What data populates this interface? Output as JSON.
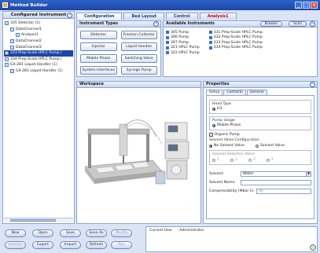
{
  "window": {
    "title": "Method Builder"
  },
  "left_panel": {
    "title": "Configured Instrument",
    "tree": [
      "335 Detector (1)",
      "DataChannel1",
      "Analysis1",
      "DataChannel2",
      "DataChannel3",
      "333 Prep-Scale HPLC Pump (",
      "334 Prep-Scale HPLC Pump (",
      "GX-281 Liquid Handler (1)",
      "GX-281 Liquid Handler (1)"
    ]
  },
  "tabs": [
    "Configuration",
    "Bed Layout",
    "Control",
    "Analysis1"
  ],
  "instrument_types": {
    "title": "Instrument Types",
    "buttons": [
      "Detector",
      "Fraction Collector",
      "Injector",
      "Liquid Handler",
      "Mobile Phase",
      "Switching Valve",
      "System Interfaces",
      "Syringe Pump"
    ]
  },
  "available": {
    "title": "Available Instruments",
    "browse": "Browse",
    "scan": "Scan",
    "col1": [
      "305 Pump",
      "306 Pump",
      "307 Pump",
      "321 HPLC Pump",
      "322 HPLC Pump"
    ],
    "col2": [
      "331 Prep-Scale HPLC Pump",
      "332 Prep-Scale HPLC Pump",
      "333 Prep-Scale HPLC Pump",
      "334 Prep-Scale HPLC Pump"
    ]
  },
  "workspace": {
    "title": "Workspace"
  },
  "properties": {
    "title": "Properties",
    "tabs": [
      "Setup",
      "Contacts",
      "General"
    ],
    "head_type_label": "Head Type",
    "head_type_value": "H3",
    "pump_usage_label": "Pump Usage",
    "pump_usage_value": "Mobile Phase",
    "organic_pump": "Organic Pump",
    "solvent_valve_config_label": "Solvent Valve Configuration",
    "no_solvent_valve": "No Solvent Valve",
    "solvent_valve": "Solvent Valve",
    "solvent_selection_label": "Solvent Selection Valve",
    "ssv_options": [
      "1",
      "2",
      "3",
      "4"
    ],
    "solvent_label": "Solvent:",
    "solvent_value": "Water",
    "solvent_name_label": "Solvent Name:",
    "solvent_name_value": "",
    "compressibility_label": "Compressibility (Mbar-1):",
    "compressibility_value": "46"
  },
  "bottom_buttons": {
    "new": "New",
    "open": "Open",
    "save": "Save",
    "save_as": "Save As",
    "modify": "Modify",
    "validate": "Validate",
    "export": "Export",
    "import": "Import",
    "refresh": "Refresh",
    "run": "Run"
  },
  "status": {
    "current_user_label": "Current User",
    "current_user_value": ": Administrator"
  },
  "colors": {
    "titlebar": "#1c46a8",
    "panel_border": "#8ea5cf",
    "background": "#dbe4f4",
    "analysis_tab_text": "#c2000b"
  }
}
